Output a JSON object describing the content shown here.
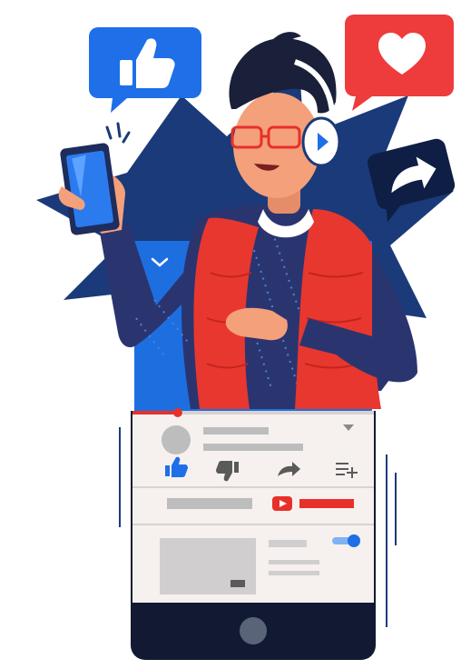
{
  "scene": {
    "description_free": true
  },
  "colors": {
    "navy": "#1B3A7A",
    "deep_navy": "#0F1E45",
    "blue_bg": "#1D6FE0",
    "like_blue": "#1E6FE8",
    "heart_red": "#EE3B3B",
    "vest_red": "#E8372F",
    "skin": "#F4A07B",
    "hair": "#1A1F3A",
    "phone_frame": "#121A33",
    "panel": "#F6F1EE",
    "placeholder_gray": "#BDBDBD",
    "play_red": "#E8302A"
  },
  "icons": {
    "like_bubble": "thumbs-up-icon",
    "heart_bubble": "heart-icon",
    "share_bubble": "share-arrow-icon",
    "collapse": "chevron-down-icon",
    "like": "like-icon",
    "dislike": "dislike-icon",
    "share": "share-icon",
    "add_playlist": "add-to-playlist-icon",
    "play": "play-icon",
    "toggle": "toggle-icon",
    "home_button": "home-button-icon"
  },
  "video": {
    "progress": 0.25,
    "toggle_on": true
  }
}
